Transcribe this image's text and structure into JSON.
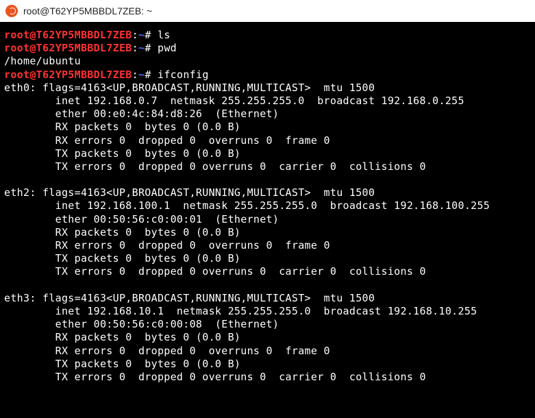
{
  "titlebar": {
    "title": "root@T62YP5MBBDL7ZEB: ~"
  },
  "prompt": {
    "user_host": "root@T62YP5MBBDL7ZEB",
    "sep": ":",
    "cwd": "~",
    "suffix": "#"
  },
  "commands": {
    "c1": "ls",
    "c2": "pwd",
    "pwd_output": "/home/ubuntu",
    "c3": "ifconfig"
  },
  "if": {
    "eth0": {
      "l1": "eth0: flags=4163<UP,BROADCAST,RUNNING,MULTICAST>  mtu 1500",
      "l2": "        inet 192.168.0.7  netmask 255.255.255.0  broadcast 192.168.0.255",
      "l3": "        ether 00:e0:4c:84:d8:26  (Ethernet)",
      "l4": "        RX packets 0  bytes 0 (0.0 B)",
      "l5": "        RX errors 0  dropped 0  overruns 0  frame 0",
      "l6": "        TX packets 0  bytes 0 (0.0 B)",
      "l7": "        TX errors 0  dropped 0 overruns 0  carrier 0  collisions 0"
    },
    "eth2": {
      "l1": "eth2: flags=4163<UP,BROADCAST,RUNNING,MULTICAST>  mtu 1500",
      "l2": "        inet 192.168.100.1  netmask 255.255.255.0  broadcast 192.168.100.255",
      "l3": "        ether 00:50:56:c0:00:01  (Ethernet)",
      "l4": "        RX packets 0  bytes 0 (0.0 B)",
      "l5": "        RX errors 0  dropped 0  overruns 0  frame 0",
      "l6": "        TX packets 0  bytes 0 (0.0 B)",
      "l7": "        TX errors 0  dropped 0 overruns 0  carrier 0  collisions 0"
    },
    "eth3": {
      "l1": "eth3: flags=4163<UP,BROADCAST,RUNNING,MULTICAST>  mtu 1500",
      "l2": "        inet 192.168.10.1  netmask 255.255.255.0  broadcast 192.168.10.255",
      "l3": "        ether 00:50:56:c0:00:08  (Ethernet)",
      "l4": "        RX packets 0  bytes 0 (0.0 B)",
      "l5": "        RX errors 0  dropped 0  overruns 0  frame 0",
      "l6": "        TX packets 0  bytes 0 (0.0 B)",
      "l7": "        TX errors 0  dropped 0 overruns 0  carrier 0  collisions 0"
    }
  }
}
